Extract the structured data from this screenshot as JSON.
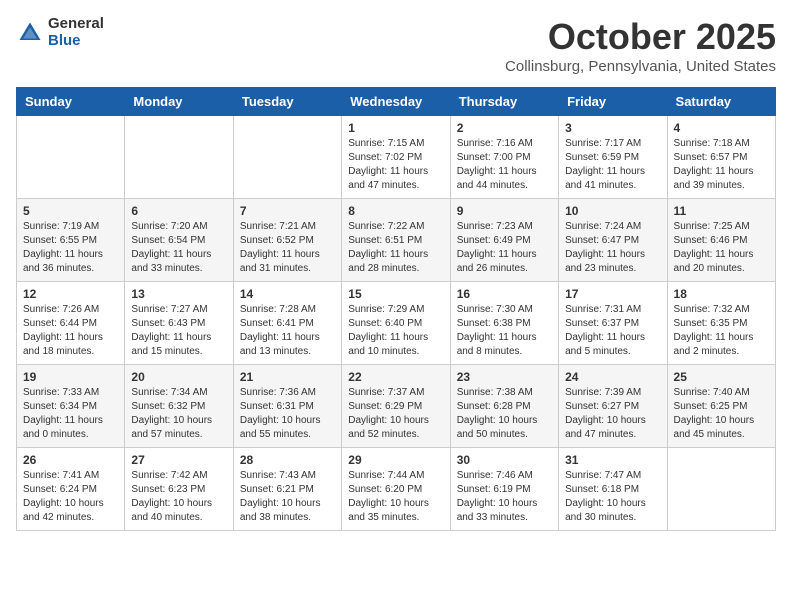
{
  "header": {
    "logo_general": "General",
    "logo_blue": "Blue",
    "month": "October 2025",
    "location": "Collinsburg, Pennsylvania, United States"
  },
  "days_of_week": [
    "Sunday",
    "Monday",
    "Tuesday",
    "Wednesday",
    "Thursday",
    "Friday",
    "Saturday"
  ],
  "weeks": [
    [
      {
        "day": "",
        "sunrise": "",
        "sunset": "",
        "daylight": ""
      },
      {
        "day": "",
        "sunrise": "",
        "sunset": "",
        "daylight": ""
      },
      {
        "day": "",
        "sunrise": "",
        "sunset": "",
        "daylight": ""
      },
      {
        "day": "1",
        "sunrise": "Sunrise: 7:15 AM",
        "sunset": "Sunset: 7:02 PM",
        "daylight": "Daylight: 11 hours and 47 minutes."
      },
      {
        "day": "2",
        "sunrise": "Sunrise: 7:16 AM",
        "sunset": "Sunset: 7:00 PM",
        "daylight": "Daylight: 11 hours and 44 minutes."
      },
      {
        "day": "3",
        "sunrise": "Sunrise: 7:17 AM",
        "sunset": "Sunset: 6:59 PM",
        "daylight": "Daylight: 11 hours and 41 minutes."
      },
      {
        "day": "4",
        "sunrise": "Sunrise: 7:18 AM",
        "sunset": "Sunset: 6:57 PM",
        "daylight": "Daylight: 11 hours and 39 minutes."
      }
    ],
    [
      {
        "day": "5",
        "sunrise": "Sunrise: 7:19 AM",
        "sunset": "Sunset: 6:55 PM",
        "daylight": "Daylight: 11 hours and 36 minutes."
      },
      {
        "day": "6",
        "sunrise": "Sunrise: 7:20 AM",
        "sunset": "Sunset: 6:54 PM",
        "daylight": "Daylight: 11 hours and 33 minutes."
      },
      {
        "day": "7",
        "sunrise": "Sunrise: 7:21 AM",
        "sunset": "Sunset: 6:52 PM",
        "daylight": "Daylight: 11 hours and 31 minutes."
      },
      {
        "day": "8",
        "sunrise": "Sunrise: 7:22 AM",
        "sunset": "Sunset: 6:51 PM",
        "daylight": "Daylight: 11 hours and 28 minutes."
      },
      {
        "day": "9",
        "sunrise": "Sunrise: 7:23 AM",
        "sunset": "Sunset: 6:49 PM",
        "daylight": "Daylight: 11 hours and 26 minutes."
      },
      {
        "day": "10",
        "sunrise": "Sunrise: 7:24 AM",
        "sunset": "Sunset: 6:47 PM",
        "daylight": "Daylight: 11 hours and 23 minutes."
      },
      {
        "day": "11",
        "sunrise": "Sunrise: 7:25 AM",
        "sunset": "Sunset: 6:46 PM",
        "daylight": "Daylight: 11 hours and 20 minutes."
      }
    ],
    [
      {
        "day": "12",
        "sunrise": "Sunrise: 7:26 AM",
        "sunset": "Sunset: 6:44 PM",
        "daylight": "Daylight: 11 hours and 18 minutes."
      },
      {
        "day": "13",
        "sunrise": "Sunrise: 7:27 AM",
        "sunset": "Sunset: 6:43 PM",
        "daylight": "Daylight: 11 hours and 15 minutes."
      },
      {
        "day": "14",
        "sunrise": "Sunrise: 7:28 AM",
        "sunset": "Sunset: 6:41 PM",
        "daylight": "Daylight: 11 hours and 13 minutes."
      },
      {
        "day": "15",
        "sunrise": "Sunrise: 7:29 AM",
        "sunset": "Sunset: 6:40 PM",
        "daylight": "Daylight: 11 hours and 10 minutes."
      },
      {
        "day": "16",
        "sunrise": "Sunrise: 7:30 AM",
        "sunset": "Sunset: 6:38 PM",
        "daylight": "Daylight: 11 hours and 8 minutes."
      },
      {
        "day": "17",
        "sunrise": "Sunrise: 7:31 AM",
        "sunset": "Sunset: 6:37 PM",
        "daylight": "Daylight: 11 hours and 5 minutes."
      },
      {
        "day": "18",
        "sunrise": "Sunrise: 7:32 AM",
        "sunset": "Sunset: 6:35 PM",
        "daylight": "Daylight: 11 hours and 2 minutes."
      }
    ],
    [
      {
        "day": "19",
        "sunrise": "Sunrise: 7:33 AM",
        "sunset": "Sunset: 6:34 PM",
        "daylight": "Daylight: 11 hours and 0 minutes."
      },
      {
        "day": "20",
        "sunrise": "Sunrise: 7:34 AM",
        "sunset": "Sunset: 6:32 PM",
        "daylight": "Daylight: 10 hours and 57 minutes."
      },
      {
        "day": "21",
        "sunrise": "Sunrise: 7:36 AM",
        "sunset": "Sunset: 6:31 PM",
        "daylight": "Daylight: 10 hours and 55 minutes."
      },
      {
        "day": "22",
        "sunrise": "Sunrise: 7:37 AM",
        "sunset": "Sunset: 6:29 PM",
        "daylight": "Daylight: 10 hours and 52 minutes."
      },
      {
        "day": "23",
        "sunrise": "Sunrise: 7:38 AM",
        "sunset": "Sunset: 6:28 PM",
        "daylight": "Daylight: 10 hours and 50 minutes."
      },
      {
        "day": "24",
        "sunrise": "Sunrise: 7:39 AM",
        "sunset": "Sunset: 6:27 PM",
        "daylight": "Daylight: 10 hours and 47 minutes."
      },
      {
        "day": "25",
        "sunrise": "Sunrise: 7:40 AM",
        "sunset": "Sunset: 6:25 PM",
        "daylight": "Daylight: 10 hours and 45 minutes."
      }
    ],
    [
      {
        "day": "26",
        "sunrise": "Sunrise: 7:41 AM",
        "sunset": "Sunset: 6:24 PM",
        "daylight": "Daylight: 10 hours and 42 minutes."
      },
      {
        "day": "27",
        "sunrise": "Sunrise: 7:42 AM",
        "sunset": "Sunset: 6:23 PM",
        "daylight": "Daylight: 10 hours and 40 minutes."
      },
      {
        "day": "28",
        "sunrise": "Sunrise: 7:43 AM",
        "sunset": "Sunset: 6:21 PM",
        "daylight": "Daylight: 10 hours and 38 minutes."
      },
      {
        "day": "29",
        "sunrise": "Sunrise: 7:44 AM",
        "sunset": "Sunset: 6:20 PM",
        "daylight": "Daylight: 10 hours and 35 minutes."
      },
      {
        "day": "30",
        "sunrise": "Sunrise: 7:46 AM",
        "sunset": "Sunset: 6:19 PM",
        "daylight": "Daylight: 10 hours and 33 minutes."
      },
      {
        "day": "31",
        "sunrise": "Sunrise: 7:47 AM",
        "sunset": "Sunset: 6:18 PM",
        "daylight": "Daylight: 10 hours and 30 minutes."
      },
      {
        "day": "",
        "sunrise": "",
        "sunset": "",
        "daylight": ""
      }
    ]
  ]
}
